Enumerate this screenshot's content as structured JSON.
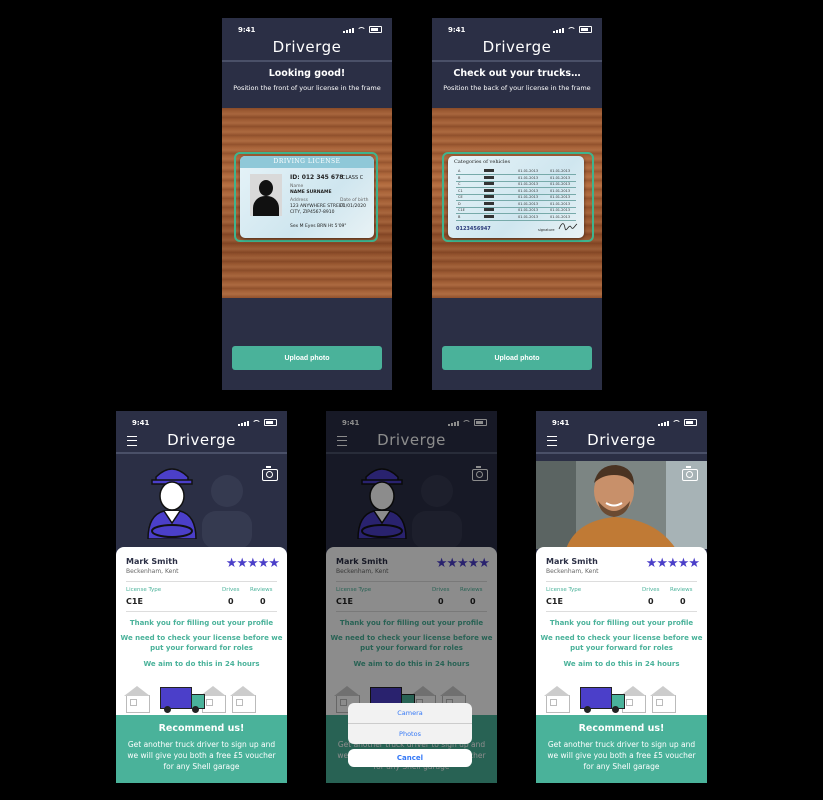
{
  "app": {
    "logo": "Driverge",
    "status_time": "9:41"
  },
  "scan_front": {
    "title": "Looking good!",
    "subtitle": "Position the front of your license in the frame",
    "button": "Upload photo",
    "license": {
      "header": "DRIVING LICENSE",
      "id": "ID: 012 345 678",
      "class": "CLASS C",
      "name_label": "Name",
      "name": "NAME SURNAME",
      "address_label": "Address",
      "address_1": "123 ANYWHERE STREET",
      "address_2": "CITY, ZIP4567-8910",
      "dob_label": "Date of birth",
      "dob": "01/01/2020",
      "footer": "Sex M   Eyes BRN   Ht 5'09\""
    }
  },
  "scan_back": {
    "title": "Check out your trucks…",
    "subtitle": "Position the back of your license in the frame",
    "button": "Upload photo",
    "license": {
      "header": "Categories of vehicles",
      "categories": [
        "A",
        "B",
        "C",
        "C1",
        "CE",
        "D",
        "C1E",
        "B"
      ],
      "date": "01.01.2013",
      "number": "0123456947",
      "signature_label": "signature"
    }
  },
  "profile": {
    "name": "Mark Smith",
    "location": "Beckenham, Kent",
    "rating": "★★★★★",
    "license_type_label": "License Type",
    "license_type": "C1E",
    "drives_label": "Drives",
    "drives": "0",
    "reviews_label": "Reviews",
    "reviews": "0",
    "msg_1": "Thank you for filling out your profile",
    "msg_2": "We need to check your license before we put your forward for roles",
    "msg_3": "We aim to do this in 24 hours",
    "recommend_title": "Recommend us!",
    "recommend_body": "Get another truck driver to sign up and we will give you both a free £5 voucher for any Shell garage"
  },
  "action_sheet": {
    "camera": "Camera",
    "photos": "Photos",
    "cancel": "Cancel"
  },
  "colors": {
    "accent": "#4ab29a",
    "navy": "#2b2f45",
    "star": "#4b3fc9"
  }
}
